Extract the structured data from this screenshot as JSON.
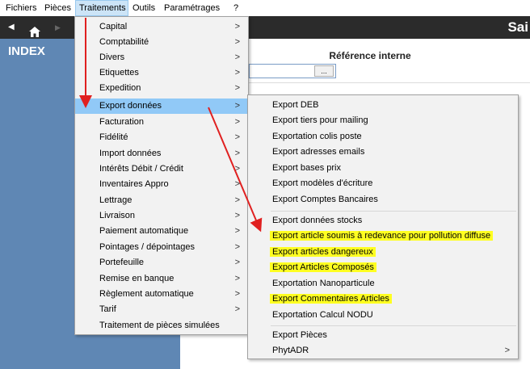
{
  "menubar": {
    "items": [
      {
        "label": "Fichiers"
      },
      {
        "label": "Pièces"
      },
      {
        "label": "Traitements"
      },
      {
        "label": "Outils"
      },
      {
        "label": "Paramétrages"
      },
      {
        "label": "?"
      }
    ]
  },
  "navbar": {
    "back_icon": "◀",
    "home_icon": "home-icon",
    "forward_icon": "▶",
    "title_fragment": "Sai"
  },
  "index_panel": {
    "title": "INDEX"
  },
  "reference": {
    "label": "Référence interne",
    "browse_label": "..."
  },
  "traitements_menu": {
    "items": [
      {
        "label": "Capital",
        "arrow": ">"
      },
      {
        "label": "Comptabilité",
        "arrow": ">"
      },
      {
        "label": "Divers",
        "arrow": ">"
      },
      {
        "label": "Etiquettes",
        "arrow": ">"
      },
      {
        "label": "Expedition",
        "arrow": ">"
      },
      {
        "label": "Export données",
        "arrow": ">"
      },
      {
        "label": "Facturation",
        "arrow": ">"
      },
      {
        "label": "Fidélité",
        "arrow": ">"
      },
      {
        "label": "Import données",
        "arrow": ">"
      },
      {
        "label": "Intérêts Débit / Crédit",
        "arrow": ">"
      },
      {
        "label": "Inventaires Appro",
        "arrow": ">"
      },
      {
        "label": "Lettrage",
        "arrow": ">"
      },
      {
        "label": "Livraison",
        "arrow": ">"
      },
      {
        "label": "Paiement automatique",
        "arrow": ">"
      },
      {
        "label": "Pointages / dépointages",
        "arrow": ">"
      },
      {
        "label": "Portefeuille",
        "arrow": ">"
      },
      {
        "label": "Remise en banque",
        "arrow": ">"
      },
      {
        "label": "Règlement automatique",
        "arrow": ">"
      },
      {
        "label": "Tarif",
        "arrow": ">"
      },
      {
        "label": "Traitement de pièces simulées",
        "arrow": ""
      }
    ],
    "highlighted_item": "Export données"
  },
  "export_submenu": {
    "items": [
      {
        "label": "Export DEB"
      },
      {
        "label": "Export tiers pour mailing"
      },
      {
        "label": "Exportation colis poste"
      },
      {
        "label": "Export adresses emails"
      },
      {
        "label": "Export bases prix"
      },
      {
        "label": "Export modèles d'écriture"
      },
      {
        "label": "Export Comptes Bancaires"
      },
      {
        "label": "Export données stocks"
      },
      {
        "label": "Export article soumis à redevance pour pollution diffuse"
      },
      {
        "label": "Export articles dangereux"
      },
      {
        "label": "Export Articles Composés"
      },
      {
        "label": "Exportation Nanoparticule"
      },
      {
        "label": "Export Commentaires Articles"
      },
      {
        "label": "Exportation Calcul NODU"
      },
      {
        "label": "Export Pièces"
      },
      {
        "label": "PhytADR",
        "arrow": ">"
      }
    ],
    "highlight_color": "#ffff21"
  },
  "colors": {
    "menu_highlight": "#91c9f7",
    "annotation_arrow": "#e02020",
    "index_panel": "#5f87b4"
  }
}
